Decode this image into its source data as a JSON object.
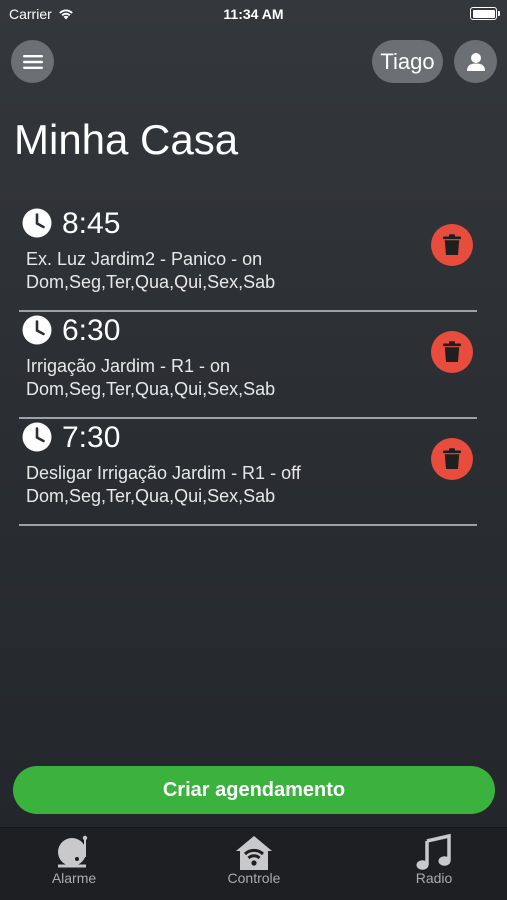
{
  "status_bar": {
    "carrier": "Carrier",
    "time": "11:34 AM"
  },
  "header": {
    "user_name": "Tiago"
  },
  "page_title": "Minha Casa",
  "schedules": [
    {
      "time": "8:45",
      "description": "Ex. Luz Jardim2 - Panico - on",
      "days": "Dom,Seg,Ter,Qua,Qui,Sex,Sab"
    },
    {
      "time": "6:30",
      "description": "Irrigação Jardim - R1 - on",
      "days": "Dom,Seg,Ter,Qua,Qui,Sex,Sab"
    },
    {
      "time": "7:30",
      "description": "Desligar Irrigação Jardim - R1 - off",
      "days": "Dom,Seg,Ter,Qua,Qui,Sex,Sab"
    }
  ],
  "create_button": "Criar agendamento",
  "tabs": [
    {
      "label": "Alarme",
      "icon": "alarm-bell-icon"
    },
    {
      "label": "Controle",
      "icon": "home-wifi-icon"
    },
    {
      "label": "Radio",
      "icon": "music-note-icon"
    }
  ],
  "colors": {
    "accent_green": "#3bb13e",
    "delete_red": "#e74c3c",
    "button_gray": "#6c6f74"
  }
}
